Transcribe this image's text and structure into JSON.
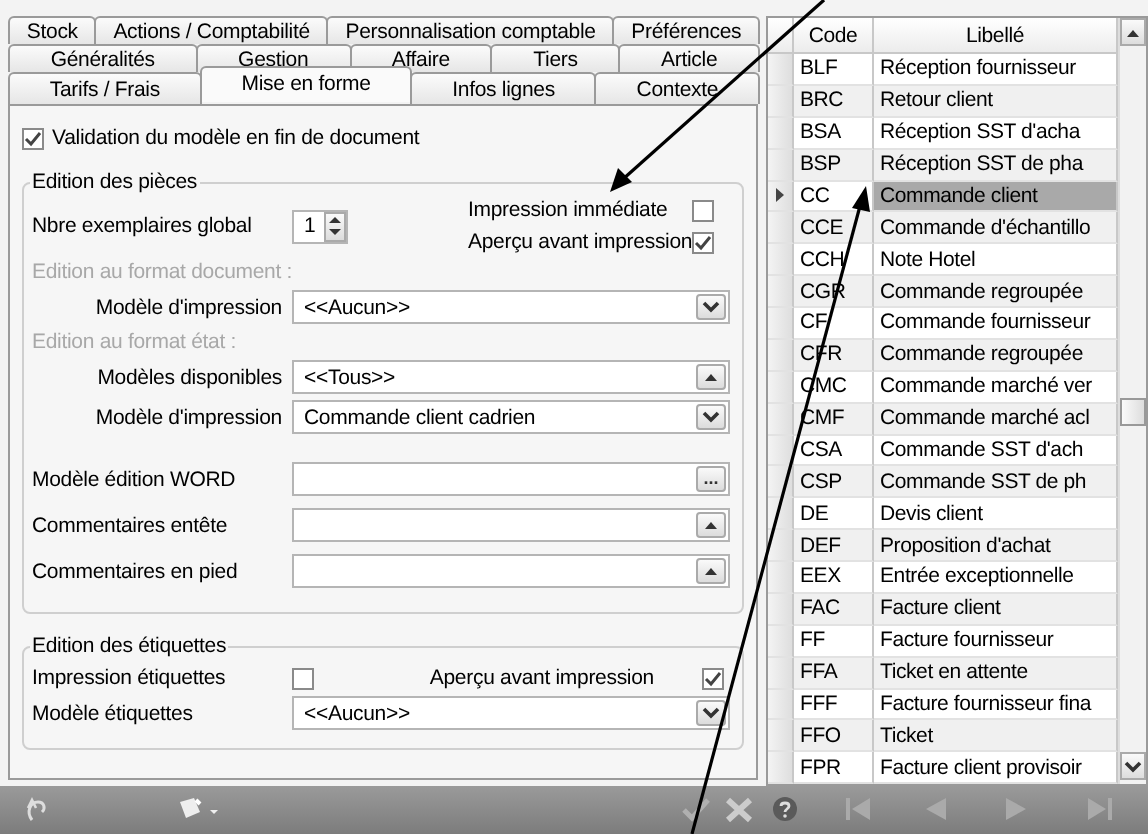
{
  "tabs": {
    "rows": [
      [
        {
          "label": "Stock",
          "selected": false
        },
        {
          "label": "Actions / Comptabilité",
          "selected": false
        },
        {
          "label": "Personnalisation comptable",
          "selected": false
        },
        {
          "label": "Préférences",
          "selected": false
        }
      ],
      [
        {
          "label": "Généralités",
          "selected": false
        },
        {
          "label": "Gestion",
          "selected": false
        },
        {
          "label": "Affaire",
          "selected": false
        },
        {
          "label": "Tiers",
          "selected": false
        },
        {
          "label": "Article",
          "selected": false
        }
      ],
      [
        {
          "label": "Tarifs / Frais",
          "selected": false
        },
        {
          "label": "Mise en forme",
          "selected": true
        },
        {
          "label": "Infos lignes",
          "selected": false
        },
        {
          "label": "Contexte",
          "selected": false
        }
      ]
    ]
  },
  "validation": {
    "label": "Validation du modèle en fin de document",
    "checked": true
  },
  "pieces": {
    "title": "Edition des pièces",
    "copies": {
      "label": "Nbre exemplaires global",
      "value": "1"
    },
    "options": [
      {
        "label": "Impression immédiate",
        "checked": false
      },
      {
        "label": "Aperçu avant impression",
        "checked": true
      }
    ],
    "subsections": [
      {
        "title": "Edition au format document :",
        "disabled": true,
        "fields": [
          {
            "label": "Modèle d'impression",
            "value": "<<Aucun>>",
            "kind": "dropdown"
          }
        ]
      },
      {
        "title": "Edition au format état :",
        "disabled": true,
        "fields": [
          {
            "label": "Modèles disponibles",
            "value": "<<Tous>>",
            "kind": "list"
          },
          {
            "label": "Modèle d'impression",
            "value": "Commande client cadrien",
            "kind": "dropdown"
          }
        ]
      }
    ],
    "fields": [
      {
        "label": "Modèle édition WORD",
        "kind": "browse",
        "button": "..."
      },
      {
        "label": "Commentaires entête",
        "kind": "list"
      },
      {
        "label": "Commentaires en pied",
        "kind": "list"
      }
    ]
  },
  "labels": {
    "title": "Edition des étiquettes",
    "options": [
      {
        "label": "Impression étiquettes",
        "checked": false
      },
      {
        "label": "Aperçu avant impression",
        "checked": true
      }
    ],
    "fields": [
      {
        "label": "Modèle étiquettes",
        "value": "<<Aucun>>",
        "kind": "dropdown"
      }
    ]
  },
  "grid": {
    "columns": [
      "Code",
      "Libellé"
    ],
    "rows": [
      {
        "code": "BLF",
        "label": "Réception fournisseur",
        "selected": false
      },
      {
        "code": "BRC",
        "label": "Retour client",
        "selected": false
      },
      {
        "code": "BSA",
        "label": "Réception SST d'acha",
        "selected": false
      },
      {
        "code": "BSP",
        "label": "Réception SST de pha",
        "selected": false
      },
      {
        "code": "CC",
        "label": "Commande client",
        "selected": true
      },
      {
        "code": "CCE",
        "label": "Commande d'échantillo",
        "selected": false
      },
      {
        "code": "CCH",
        "label": "Note Hotel",
        "selected": false
      },
      {
        "code": "CGR",
        "label": "Commande regroupée",
        "selected": false
      },
      {
        "code": "CF",
        "label": "Commande fournisseur",
        "selected": false
      },
      {
        "code": "CFR",
        "label": "Commande regroupée",
        "selected": false
      },
      {
        "code": "CMC",
        "label": "Commande marché ver",
        "selected": false
      },
      {
        "code": "CMF",
        "label": "Commande marché acl",
        "selected": false
      },
      {
        "code": "CSA",
        "label": "Commande SST d'ach",
        "selected": false
      },
      {
        "code": "CSP",
        "label": "Commande SST de ph",
        "selected": false
      },
      {
        "code": "DE",
        "label": "Devis client",
        "selected": false
      },
      {
        "code": "DEF",
        "label": "Proposition d'achat",
        "selected": false
      },
      {
        "code": "EEX",
        "label": "Entrée exceptionnelle",
        "selected": false
      },
      {
        "code": "FAC",
        "label": "Facture client",
        "selected": false
      },
      {
        "code": "FF",
        "label": "Facture fournisseur",
        "selected": false
      },
      {
        "code": "FFA",
        "label": "Ticket en attente",
        "selected": false
      },
      {
        "code": "FFF",
        "label": "Facture fournisseur fina",
        "selected": false
      },
      {
        "code": "FFO",
        "label": "Ticket",
        "selected": false
      },
      {
        "code": "FPR",
        "label": "Facture client provisoir",
        "selected": false
      }
    ]
  }
}
